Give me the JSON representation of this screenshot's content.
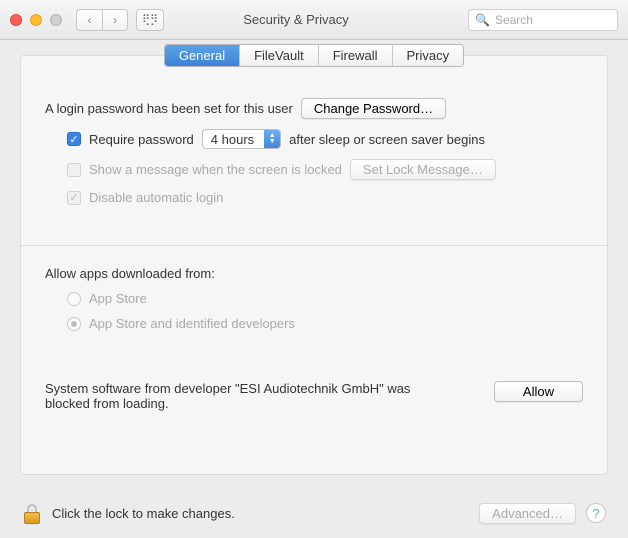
{
  "window": {
    "title": "Security & Privacy",
    "search_placeholder": "Search"
  },
  "tabs": {
    "active": "General",
    "items": [
      "General",
      "FileVault",
      "Firewall",
      "Privacy"
    ]
  },
  "login": {
    "text": "A login password has been set for this user",
    "change_btn": "Change Password…",
    "require_pw_label": "Require password",
    "require_pw_delay": "4 hours",
    "require_pw_after": "after sleep or screen saver begins",
    "show_msg_label": "Show a message when the screen is locked",
    "set_lock_btn": "Set Lock Message…",
    "disable_auto_label": "Disable automatic login"
  },
  "allow": {
    "heading": "Allow apps downloaded from:",
    "opt1": "App Store",
    "opt2": "App Store and identified developers"
  },
  "blocked": {
    "text": "System software from developer \"ESI Audiotechnik GmbH\" was blocked from loading.",
    "allow_btn": "Allow"
  },
  "footer": {
    "lock_text": "Click the lock to make changes.",
    "advanced_btn": "Advanced…"
  }
}
